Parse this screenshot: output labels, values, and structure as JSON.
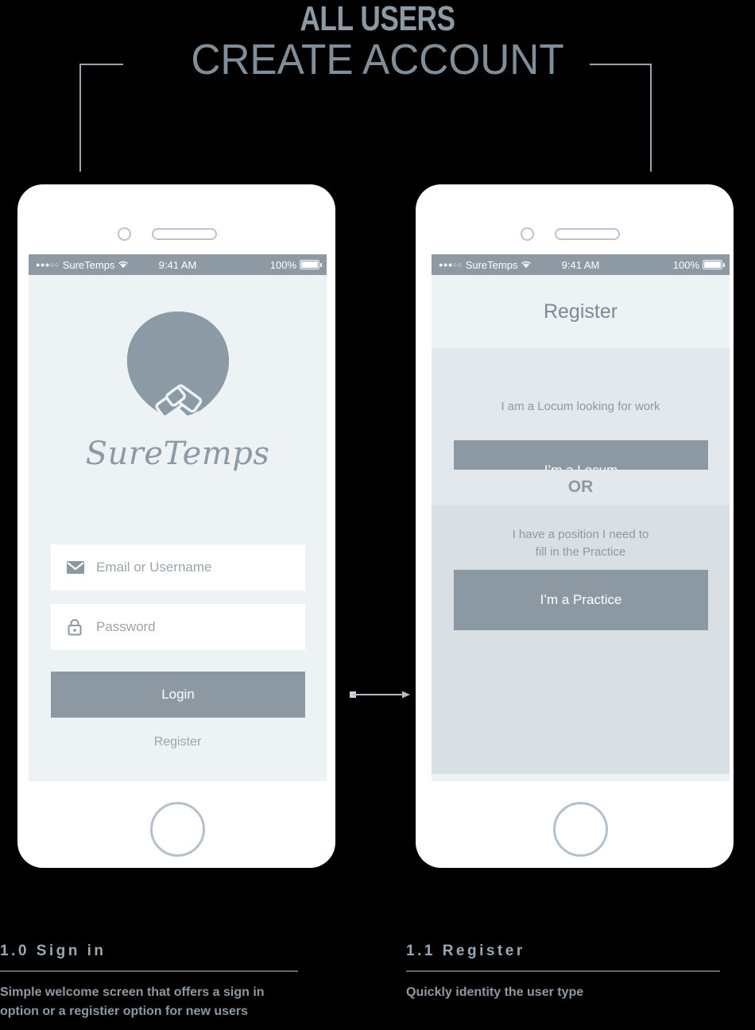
{
  "header": {
    "eyebrow": "ALL USERS",
    "title": "CREATE ACCOUNT"
  },
  "colors": {
    "background": "#000000",
    "accent_grey": "#8d99a2",
    "screen_bg": "#edf2f5",
    "panel_light": "#e2e8ec",
    "panel_dark": "#d8e0e4",
    "heading_grey": "#8c9aa5",
    "status_bar": "#8d9aa3"
  },
  "status_bar": {
    "signal_dots": "●●●○○",
    "carrier": "SureTemps",
    "wifi_icon": "wifi-icon",
    "time": "9:41 AM",
    "battery_percent": "100%",
    "battery_icon": "battery-full-icon"
  },
  "screen_signin": {
    "logo_icon": "suretemps-pin-handshake-logo",
    "wordmark": "SureTemps",
    "fields": [
      {
        "icon": "envelope-icon",
        "placeholder": "Email or Username",
        "value": ""
      },
      {
        "icon": "lock-icon",
        "placeholder": "Password",
        "value": ""
      }
    ],
    "login_button": "Login",
    "register_link": "Register"
  },
  "screen_register": {
    "title": "Register",
    "locum": {
      "caption": "I am a Locum looking for work",
      "button": "I’m a Locum"
    },
    "divider": "OR",
    "practice": {
      "caption_line1": "I have a position I need to",
      "caption_line2": "fill in the Practice",
      "button": "I’m a Practice"
    }
  },
  "captions": [
    {
      "title": "1.0 Sign in",
      "body": "Simple welcome screen that offers a sign in option or a registier option for new users"
    },
    {
      "title": "1.1 Register",
      "body": "Quickly identity the user type"
    }
  ]
}
